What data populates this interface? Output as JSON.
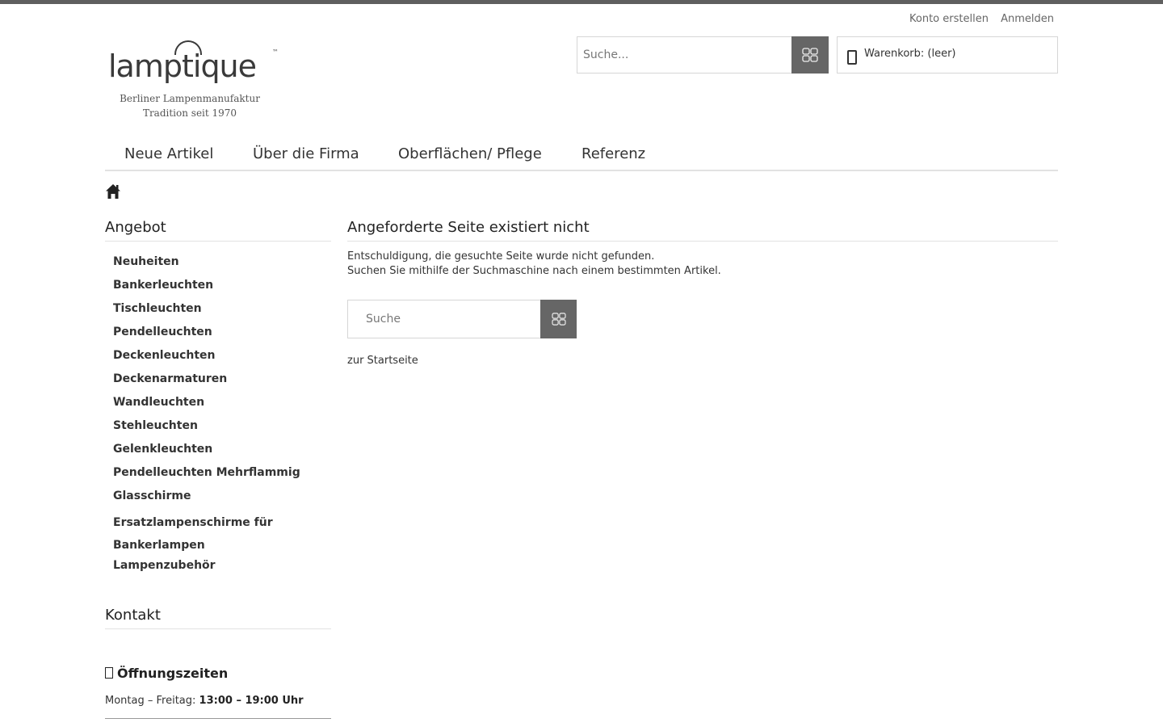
{
  "header": {
    "account_links": [
      "Konto erstellen",
      "Anmelden"
    ],
    "logo": {
      "wordmark": "lamptique",
      "tm": "™",
      "subtitle_1": "Berliner Lampenmanufaktur",
      "subtitle_2": "Tradition seit 1970"
    },
    "search": {
      "placeholder": "Suche...",
      "icon": "search-icon"
    },
    "cart": {
      "label": "Warenkorb: (leer)",
      "icon": "cart-icon"
    }
  },
  "nav": {
    "items": [
      "Neue Artikel",
      "Über die Firma",
      "Oberflächen/ Pflege",
      "Referenz"
    ]
  },
  "breadcrumb": {
    "icon": "home-icon"
  },
  "sidebar": {
    "title": "Angebot",
    "items": [
      "Neuheiten",
      "Bankerleuchten",
      "Tischleuchten",
      "Pendelleuchten",
      "Deckenleuchten",
      "Deckenarmaturen",
      "Wandleuchten",
      "Stehleuchten",
      "Gelenkleuchten",
      "Pendelleuchten Mehrflammig",
      "Glasschirme",
      "Ersatzlampenschirme für Bankerlampen",
      "Lampenzubehör"
    ],
    "contact_title": "Kontakt",
    "hours_title": "Öffnungszeiten",
    "hours_label": "Montag – Freitag:",
    "hours_value": "13:00 – 19:00 Uhr"
  },
  "main": {
    "title": "Angeforderte Seite existiert nicht",
    "message_1": "Entschuldigung, die gesuchte Seite wurde nicht gefunden.",
    "message_2": "Suchen Sie mithilfe der Suchmaschine nach einem bestimmten Artikel.",
    "search_placeholder": "Suche",
    "home_link": "zur Startseite"
  },
  "colors": {
    "topbar": "#5f5f5f",
    "search_button": "#666666",
    "border": "#d6d6d6"
  }
}
